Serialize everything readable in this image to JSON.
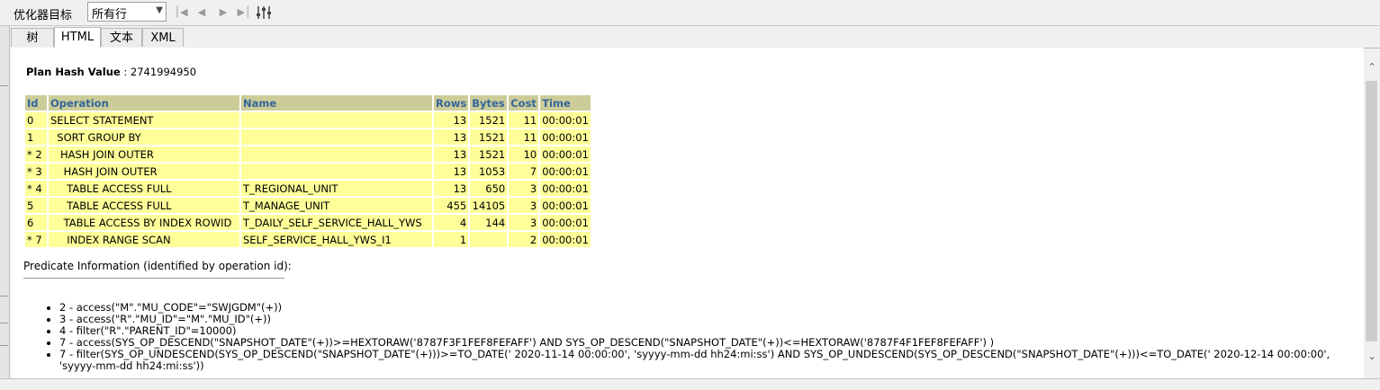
{
  "toolbar": {
    "optimizer_label": "优化器目标",
    "rows_select_value": "所有行"
  },
  "tabs": [
    {
      "label": "树"
    },
    {
      "label": "HTML"
    },
    {
      "label": "文本"
    },
    {
      "label": "XML"
    }
  ],
  "plan_hash": {
    "label": "Plan Hash Value",
    "separator": " : ",
    "value": "2741994950"
  },
  "plan_table": {
    "headers": [
      "Id",
      "Operation",
      "Name",
      "Rows",
      "Bytes",
      "Cost",
      "Time"
    ],
    "rows": [
      {
        "id": "0",
        "operation": "SELECT STATEMENT",
        "name": "",
        "rows": "13",
        "bytes": "1521",
        "cost": "11",
        "time": "00:00:01"
      },
      {
        "id": "1",
        "operation": "  SORT GROUP BY",
        "name": "",
        "rows": "13",
        "bytes": "1521",
        "cost": "11",
        "time": "00:00:01"
      },
      {
        "id": "* 2",
        "operation": "   HASH JOIN OUTER",
        "name": "",
        "rows": "13",
        "bytes": "1521",
        "cost": "10",
        "time": "00:00:01"
      },
      {
        "id": "* 3",
        "operation": "    HASH JOIN OUTER",
        "name": "",
        "rows": "13",
        "bytes": "1053",
        "cost": "7",
        "time": "00:00:01"
      },
      {
        "id": "* 4",
        "operation": "     TABLE ACCESS FULL",
        "name": "T_REGIONAL_UNIT",
        "rows": "13",
        "bytes": "650",
        "cost": "3",
        "time": "00:00:01"
      },
      {
        "id": "5",
        "operation": "     TABLE ACCESS FULL",
        "name": "T_MANAGE_UNIT",
        "rows": "455",
        "bytes": "14105",
        "cost": "3",
        "time": "00:00:01"
      },
      {
        "id": "6",
        "operation": "    TABLE ACCESS BY INDEX ROWID",
        "name": "T_DAILY_SELF_SERVICE_HALL_YWS",
        "rows": "4",
        "bytes": "144",
        "cost": "3",
        "time": "00:00:01"
      },
      {
        "id": "* 7",
        "operation": "     INDEX RANGE SCAN",
        "name": "SELF_SERVICE_HALL_YWS_I1",
        "rows": "1",
        "bytes": "",
        "cost": "2",
        "time": "00:00:01"
      }
    ]
  },
  "predicate": {
    "title": "Predicate Information (identified by operation id):",
    "items": [
      "2 - access(\"M\".\"MU_CODE\"=\"SWJGDM\"(+))",
      "3 - access(\"R\".\"MU_ID\"=\"M\".\"MU_ID\"(+))",
      "4 - filter(\"R\".\"PARENT_ID\"=10000)",
      "7 - access(SYS_OP_DESCEND(\"SNAPSHOT_DATE\"(+))>=HEXTORAW('8787F3F1FEF8FEFAFF') AND SYS_OP_DESCEND(\"SNAPSHOT_DATE\"(+))<=HEXTORAW('8787F4F1FEF8FEFAFF') )",
      "7 - filter(SYS_OP_UNDESCEND(SYS_OP_DESCEND(\"SNAPSHOT_DATE\"(+)))>=TO_DATE(' 2020-11-14 00:00:00', 'syyyy-mm-dd hh24:mi:ss') AND SYS_OP_UNDESCEND(SYS_OP_DESCEND(\"SNAPSHOT_DATE\"(+)))<=TO_DATE(' 2020-12-14 00:00:00', 'syyyy-mm-dd hh24:mi:ss'))"
    ]
  },
  "icons": {
    "first": "first-page-icon",
    "prev": "prev-page-icon",
    "next": "next-page-icon",
    "last": "last-page-icon",
    "filter": "filter-columns-icon",
    "scroll_up": "scroll-up-icon",
    "scroll_down": "scroll-down-icon"
  },
  "colors": {
    "header_bg": "#cccc99",
    "header_text": "#336699",
    "cell_bg": "#ffff99"
  }
}
